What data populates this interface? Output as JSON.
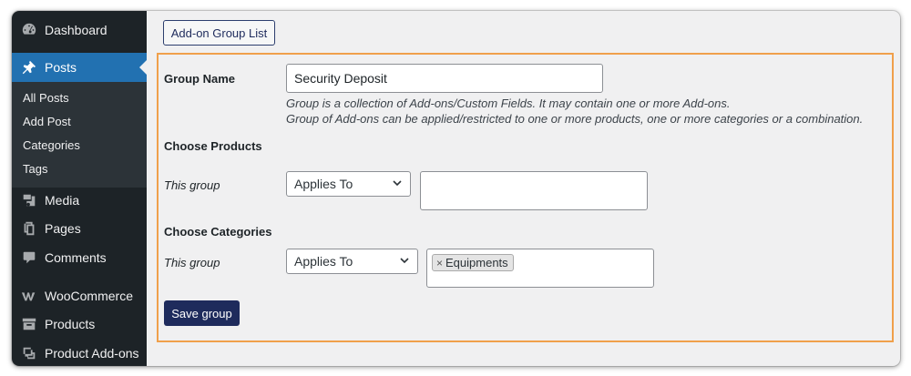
{
  "sidebar": {
    "items": [
      {
        "label": "Dashboard",
        "icon": "dashboard-icon"
      },
      {
        "label": "Posts",
        "icon": "pin-icon",
        "active": true
      },
      {
        "label": "Media",
        "icon": "media-icon"
      },
      {
        "label": "Pages",
        "icon": "pages-icon"
      },
      {
        "label": "Comments",
        "icon": "comments-icon"
      },
      {
        "label": "WooCommerce",
        "icon": "woocommerce-icon"
      },
      {
        "label": "Products",
        "icon": "products-icon"
      },
      {
        "label": "Product Add-ons",
        "icon": "addons-icon"
      }
    ],
    "submenu": [
      "All Posts",
      "Add Post",
      "Categories",
      "Tags"
    ]
  },
  "main": {
    "list_button": "Add-on Group List",
    "group_name": {
      "label": "Group Name",
      "value": "Security Deposit",
      "desc_line1": "Group is a collection of Add-ons/Custom Fields. It may contain one or more Add-ons.",
      "desc_line2": "Group of Add-ons can be applied/restricted to one or more products, one or more categories or a combination."
    },
    "choose_products": {
      "heading": "Choose Products",
      "row_label": "This group",
      "select_value": "Applies To"
    },
    "choose_categories": {
      "heading": "Choose Categories",
      "row_label": "This group",
      "select_value": "Applies To",
      "chip_remove": "×",
      "chip_label": "Equipments"
    },
    "save_button": "Save group"
  },
  "colors": {
    "sidebar_bg": "#1d2327",
    "active_bg": "#2271b1",
    "panel_border": "#f0a04b",
    "primary_button": "#1e2b5c"
  }
}
